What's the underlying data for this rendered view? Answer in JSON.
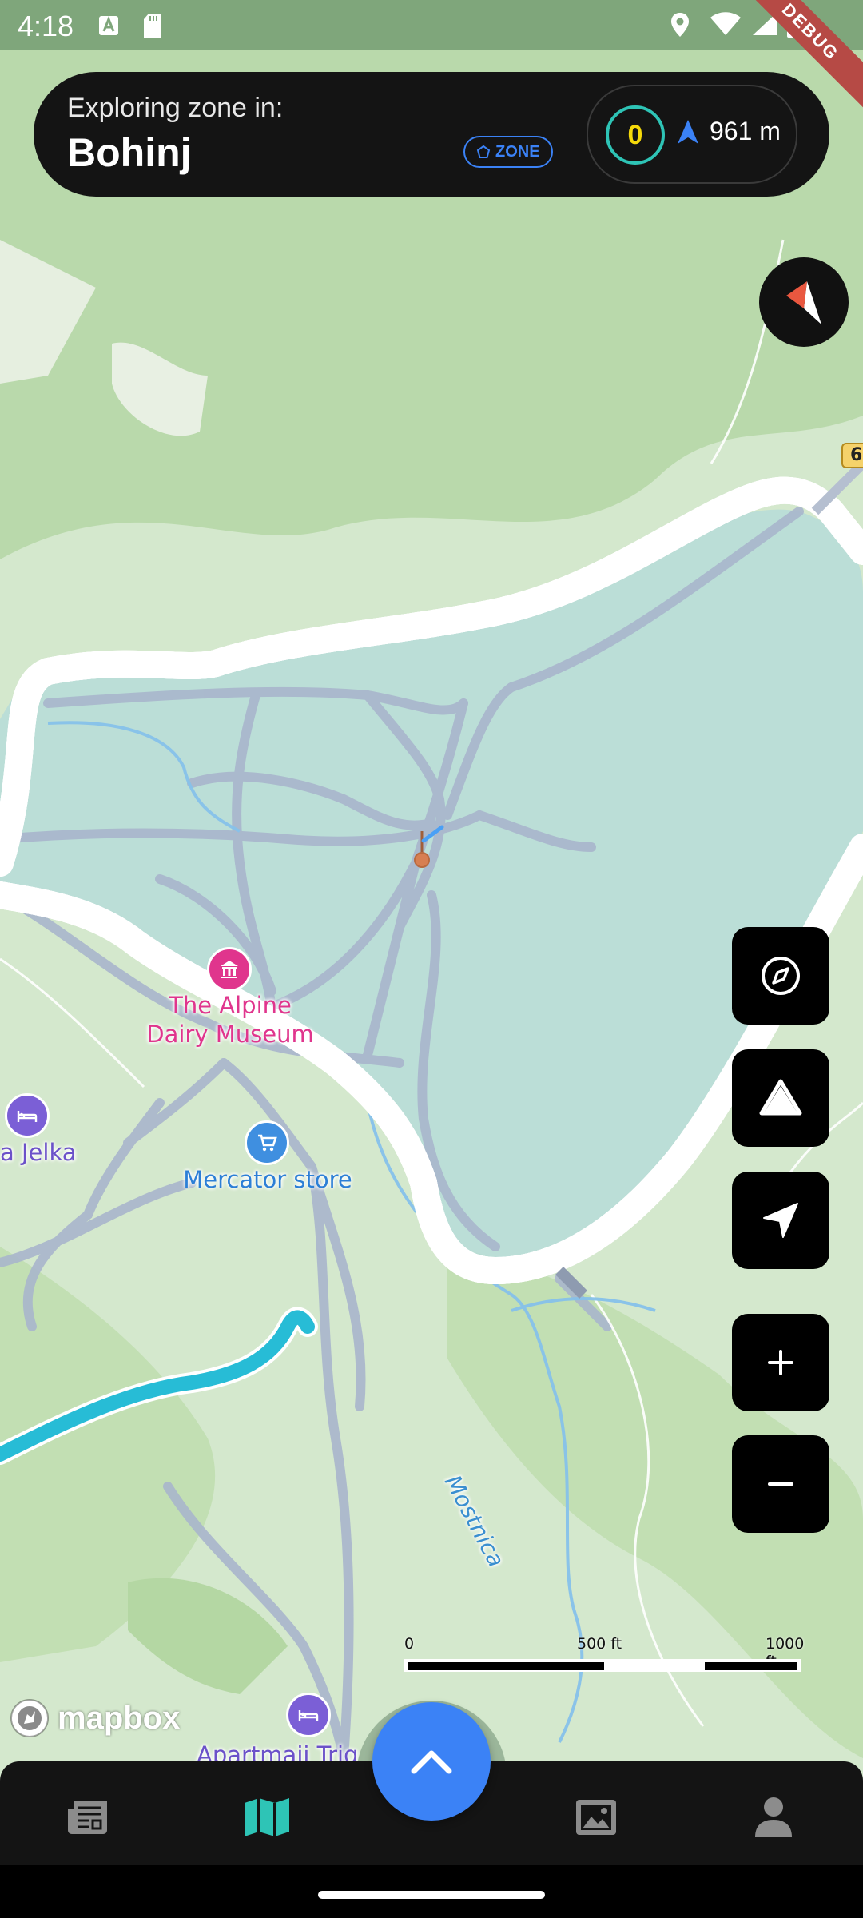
{
  "status_bar": {
    "time": "4:18",
    "debug_label": "DEBUG"
  },
  "zone_header": {
    "label": "Exploring zone in:",
    "zone_name": "Bohinj",
    "badge": "ZONE",
    "score": "0",
    "distance": "961 m"
  },
  "map": {
    "labels": {
      "museum": "The Alpine\nDairy Museum",
      "store": "Mercator store",
      "jelka": "a Jelka",
      "apartmaji": "Apartmaji Trig",
      "river": "Mostnica",
      "road_shield": "6"
    },
    "scale": {
      "left": "0",
      "mid": "500 ft",
      "right": "1000 ft"
    },
    "attribution": "mapbox"
  },
  "controls": [
    "compass-reset",
    "terrain",
    "locate",
    "zoom-in",
    "zoom-out"
  ],
  "bottom_nav": {
    "items": [
      "news",
      "map",
      "gallery",
      "profile"
    ],
    "active": "map"
  },
  "colors": {
    "accent": "#3b82f6",
    "active_nav": "#2ec4b6",
    "score_yellow": "#f5d90a",
    "zone_fill": "#b7dee0",
    "poi_pink": "#e0358d",
    "poi_blue": "#3f8fe0",
    "poi_purple": "#7b5fd6"
  }
}
